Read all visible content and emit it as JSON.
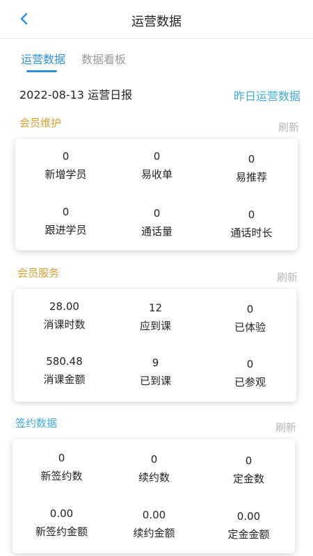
{
  "header": {
    "title": "运营数据"
  },
  "tabs": [
    {
      "label": "运营数据",
      "active": true
    },
    {
      "label": "数据看板",
      "active": false
    }
  ],
  "report": {
    "date_title": "2022-08-13 运营日报",
    "yesterday_link": "昨日运营数据"
  },
  "colors": {
    "accent": "#2f8fd8",
    "gold": "#d9a030",
    "cyan": "#3fa9d9",
    "muted": "#b5b5b5"
  },
  "sections": [
    {
      "title": "会员维护",
      "refresh": "刷新",
      "items": [
        {
          "value": "0",
          "label": "新增学员"
        },
        {
          "value": "0",
          "label": "易收单"
        },
        {
          "value": "0",
          "label": "易推荐"
        },
        {
          "value": "0",
          "label": "跟进学员"
        },
        {
          "value": "0",
          "label": "通话量"
        },
        {
          "value": "0",
          "label": "通话时长"
        }
      ]
    },
    {
      "title": "会员服务",
      "refresh": "刷新",
      "items": [
        {
          "value": "28.00",
          "label": "消课时数"
        },
        {
          "value": "12",
          "label": "应到课"
        },
        {
          "value": "0",
          "label": "已体验"
        },
        {
          "value": "580.48",
          "label": "消课金额"
        },
        {
          "value": "9",
          "label": "已到课"
        },
        {
          "value": "0",
          "label": "已参观"
        }
      ]
    },
    {
      "title": "签约数据",
      "refresh": "刷新",
      "items": [
        {
          "value": "0",
          "label": "新签约数"
        },
        {
          "value": "0",
          "label": "续约数"
        },
        {
          "value": "0",
          "label": "定金数"
        },
        {
          "value": "0.00",
          "label": "新签约金额"
        },
        {
          "value": "0.00",
          "label": "续约金额"
        },
        {
          "value": "0.00",
          "label": "定金金额"
        }
      ]
    }
  ]
}
